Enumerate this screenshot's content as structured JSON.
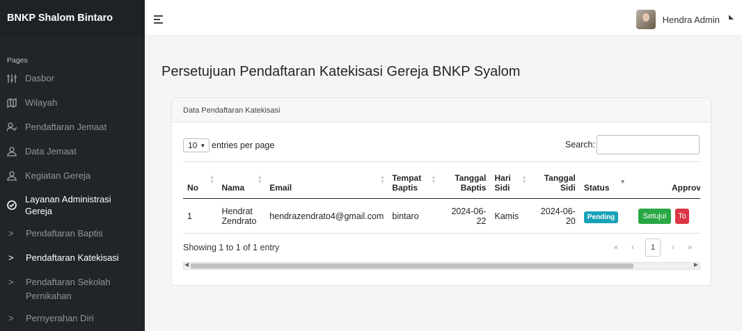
{
  "sidebar": {
    "brand": "BNKP Shalom Bintaro",
    "heading": "Pages",
    "items": [
      {
        "label": "Dasbor",
        "icon": "sliders-icon"
      },
      {
        "label": "Wilayah",
        "icon": "map-icon"
      },
      {
        "label": "Pendaftaran Jemaat",
        "icon": "user-check-icon"
      },
      {
        "label": "Data Jemaat",
        "icon": "user-icon"
      },
      {
        "label": "Kegiatan Gereja",
        "icon": "user-icon"
      },
      {
        "label_line1": "Layanan Administrasi",
        "label_line2": "Gereja",
        "icon": "check-circle-icon"
      }
    ],
    "subitems": [
      {
        "label": "Pendaftaran Baptis"
      },
      {
        "label": "Pendaftaran Katekisasi"
      },
      {
        "label_line1": "Pendaftaran Sekolah",
        "label_line2": "Pernikahan"
      },
      {
        "label": "Pernyerahan Diri"
      }
    ]
  },
  "topbar": {
    "user_name": "Hendra Admin"
  },
  "page": {
    "title": "Persetujuan Pendaftaran Katekisasi Gereja BNKP Syalom"
  },
  "card": {
    "header": "Data Pendaftaran Katekisasi",
    "entries_value": "10",
    "entries_label": "entries per page",
    "search_label": "Search:",
    "search_value": ""
  },
  "table": {
    "headers": {
      "no": "No",
      "nama": "Nama",
      "email": "Email",
      "tempat_1": "Tempat",
      "tempat_2": "Baptis",
      "tgl_baptis_1": "Tanggal",
      "tgl_baptis_2": "Baptis",
      "hari_1": "Hari",
      "hari_2": "Sidi",
      "tgl_sidi_1": "Tanggal",
      "tgl_sidi_2": "Sidi",
      "status": "Status",
      "approval": "Approval"
    },
    "rows": [
      {
        "no": "1",
        "nama_1": "Hendrat",
        "nama_2": "Zendrato",
        "email": "hendrazendrato4@gmail.com",
        "tempat": "bintaro",
        "tgl_baptis_1": "2024-06-",
        "tgl_baptis_2": "22",
        "hari": "Kamis",
        "tgl_sidi_1": "2024-06-",
        "tgl_sidi_2": "20",
        "status": "Pending",
        "approve": "Setujui",
        "reject": "To"
      }
    ]
  },
  "footer": {
    "info": "Showing 1 to 1 of 1 entry",
    "first": "«",
    "prev": "‹",
    "page": "1",
    "next": "›",
    "last": "»"
  },
  "colors": {
    "sidebar": "#212529",
    "badge": "#17a2b8",
    "approve": "#28a745",
    "reject": "#dc3545"
  }
}
